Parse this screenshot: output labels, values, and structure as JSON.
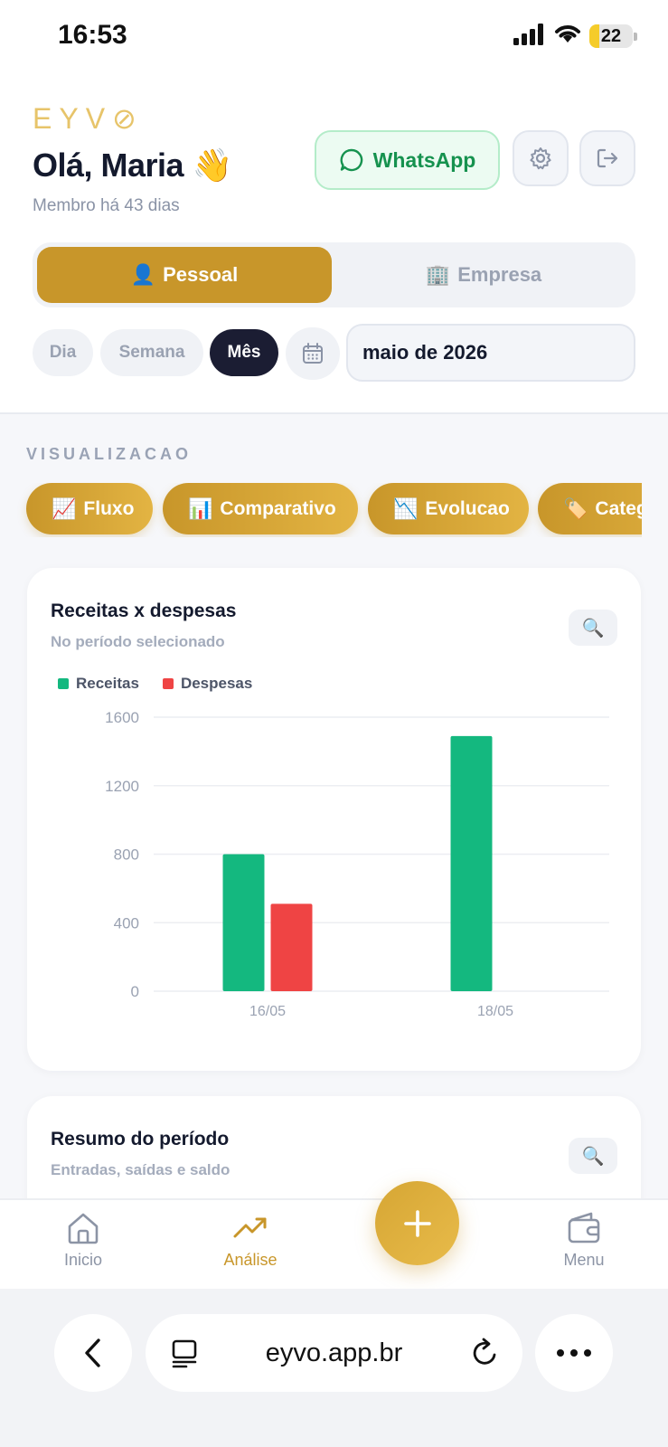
{
  "status_bar": {
    "time": "16:53",
    "battery": "22",
    "battery_level": 0.22
  },
  "header": {
    "brand": "EYV⊘",
    "greeting": "Olá, Maria 👋",
    "member_since": "Membro há 43 dias",
    "whatsapp_label": "WhatsApp"
  },
  "profile_toggle": {
    "personal": {
      "emoji": "👤",
      "label": "Pessoal"
    },
    "business": {
      "emoji": "🏢",
      "label": "Empresa"
    }
  },
  "period": {
    "options": [
      "Dia",
      "Semana",
      "Mês"
    ],
    "selected": "Mês",
    "date_value": "maio de 2026"
  },
  "visualization": {
    "title": "VISUALIZACAO",
    "chips": [
      {
        "emoji": "📈",
        "label": "Fluxo"
      },
      {
        "emoji": "📊",
        "label": "Comparativo"
      },
      {
        "emoji": "📉",
        "label": "Evolucao"
      },
      {
        "emoji": "🏷️",
        "label": "Categorias"
      }
    ]
  },
  "chart_card": {
    "title": "Receitas x despesas",
    "subtitle": "No período selecionado",
    "zoom_icon": "🔍"
  },
  "chart_data": {
    "type": "bar",
    "categories": [
      "16/05",
      "18/05"
    ],
    "series": [
      {
        "name": "Receitas",
        "values": [
          800,
          1490
        ],
        "color": "#14b87f"
      },
      {
        "name": "Despesas",
        "values": [
          510,
          0
        ],
        "color": "#ef4444"
      }
    ],
    "ylim": [
      0,
      1600
    ],
    "yticks": [
      0,
      400,
      800,
      1200,
      1600
    ],
    "grid": true,
    "legend": "top-left"
  },
  "summary_card": {
    "title": "Resumo do período",
    "subtitle": "Entradas, saídas e saldo",
    "zoom_icon": "🔍"
  },
  "bottom_nav": {
    "items": [
      {
        "label": "Inicio",
        "icon": "home-icon"
      },
      {
        "label": "Análise",
        "icon": "trending-up-icon"
      },
      {
        "label": "Menu",
        "icon": "wallet-icon"
      }
    ],
    "active": "Análise",
    "accent": "#c8962a"
  },
  "browser": {
    "url": "eyvo.app.br"
  }
}
